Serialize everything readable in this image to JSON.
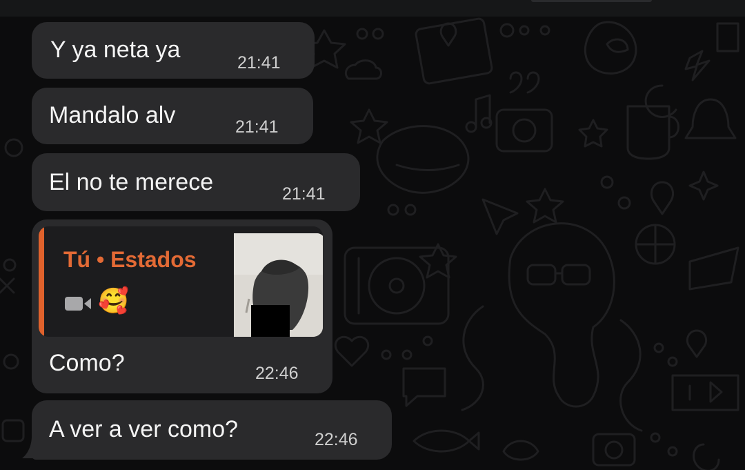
{
  "messages": [
    {
      "text": "Y ya neta ya",
      "time": "21:41"
    },
    {
      "text": "Mandalo alv",
      "time": "21:41"
    },
    {
      "text": "El no te merece",
      "time": "21:41"
    },
    {
      "quote": {
        "author": "Tú • Estados",
        "media_icon": "video-camera-icon",
        "emoji": "🥰"
      },
      "text": "Como?",
      "time": "22:46"
    },
    {
      "text": "A ver a ver como?",
      "time": "22:46"
    }
  ],
  "colors": {
    "background": "#0c0c0d",
    "bubble": "#2a2a2c",
    "quote_background": "#1c1c1e",
    "quote_accent": "#e0622c",
    "doodle_stroke": "#1f1f21"
  }
}
